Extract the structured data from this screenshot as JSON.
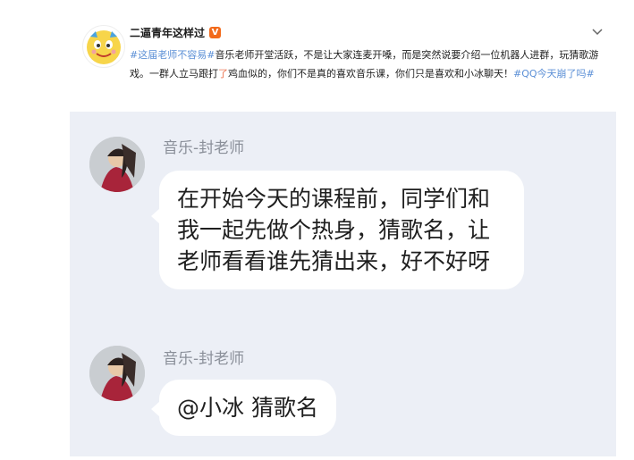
{
  "post": {
    "username": "二逼青年这样过",
    "verified_badge": "V",
    "icons": {
      "verified": "verified-badge-icon",
      "menu": "chevron-down-icon",
      "avatar": "cartoon-face-avatar"
    },
    "text_segments": [
      {
        "text": "#这届老师不容易#",
        "type": "hashtag"
      },
      {
        "text": "音乐老师开堂活跃，不是让大家连麦开嗓，而是突然说要介绍一位机器人进群，玩猜歌游戏。一群人立马跟打",
        "type": "plain"
      },
      {
        "text": "了",
        "type": "highlight"
      },
      {
        "text": "鸡血似的，你们不是真的喜欢音乐课，你们只是喜欢和小冰聊天！",
        "type": "plain"
      },
      {
        "text": "#QQ今天崩了吗#",
        "type": "hashtag"
      }
    ],
    "colors": {
      "hashtag": "#5b8fd6",
      "highlight": "#eb7350",
      "badge": "#f26a1b",
      "chat_background": "#eceff6"
    }
  },
  "chat": {
    "messages": [
      {
        "sender": "音乐-封老师",
        "text": "在开始今天的课程前，同学们和我一起先做个热身，猜歌名，让老师看看谁先猜出来，好不好呀"
      },
      {
        "sender": "音乐-封老师",
        "text": "@小冰 猜歌名"
      }
    ]
  }
}
